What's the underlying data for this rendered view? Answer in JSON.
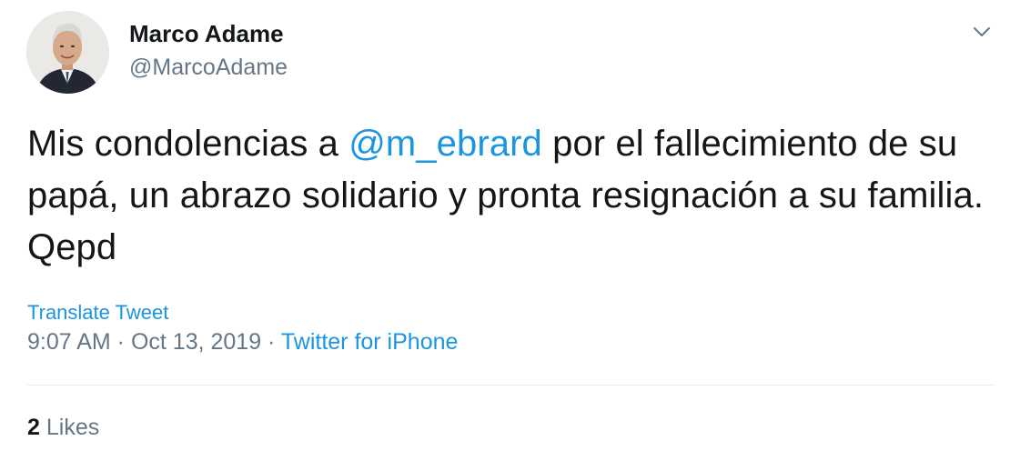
{
  "tweet": {
    "author": {
      "display_name": "Marco Adame",
      "handle": "@MarcoAdame"
    },
    "menu_icon": "chevron-down-icon",
    "text_before": "Mis condolencias a ",
    "mention": "@m_ebrard",
    "text_after": " por el fallecimiento de su papá, un abrazo solidario y pronta resignación a su familia. Qepd",
    "translate_label": "Translate Tweet",
    "time": "9:07 AM",
    "separator": " · ",
    "date": "Oct 13, 2019",
    "source": "Twitter for iPhone",
    "likes_count": "2",
    "likes_label": "Likes"
  },
  "colors": {
    "link": "#1b95e0",
    "text": "#14171a",
    "secondary": "#657786",
    "divider": "#e6ecf0"
  }
}
